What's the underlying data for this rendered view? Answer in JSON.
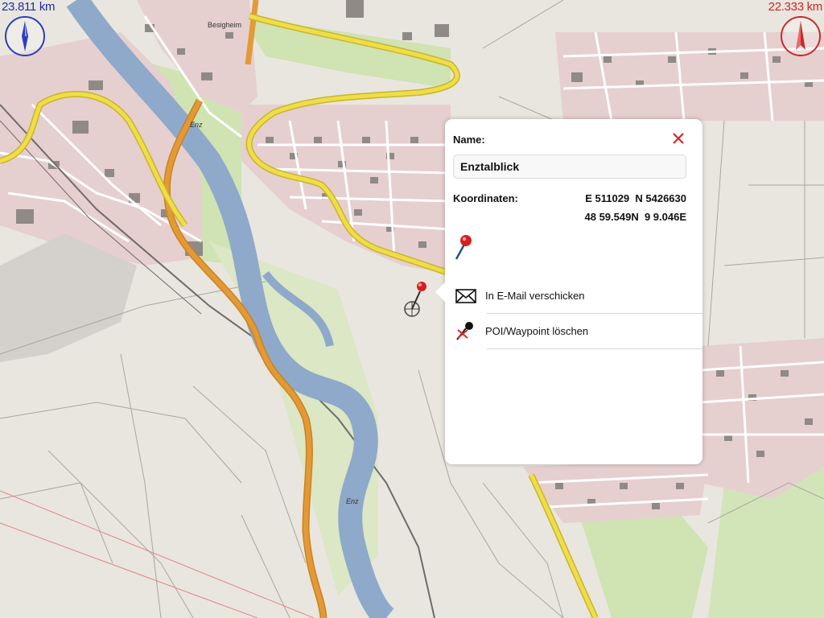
{
  "map": {
    "distance_left": "23.811 km",
    "distance_right": "22.333 km",
    "town_label": "Besigheim",
    "river_label": "Enz",
    "colors": {
      "background": "#e9e6df",
      "residential": "#e6cfcf",
      "river": "#8ea9c9",
      "main_road": "#e9d63f",
      "primary_road": "#e0922c",
      "green": "#cfe3b3"
    },
    "compass_left_icon": "compass-needle-blue-icon",
    "compass_right_icon": "compass-needle-red-icon"
  },
  "popup": {
    "name_label": "Name:",
    "name_value": "Enztalblick",
    "coord_label": "Koordinaten:",
    "coord_utm": "E 511029  N 5426630",
    "coord_geo": "48 59.549N  9 9.046E",
    "close_icon": "close-icon",
    "pin_icon": "map-pin-icon",
    "actions": [
      {
        "label": "In E-Mail verschicken",
        "icon": "envelope-icon"
      },
      {
        "label": "POI/Waypoint löschen",
        "icon": "delete-pin-icon"
      }
    ]
  }
}
